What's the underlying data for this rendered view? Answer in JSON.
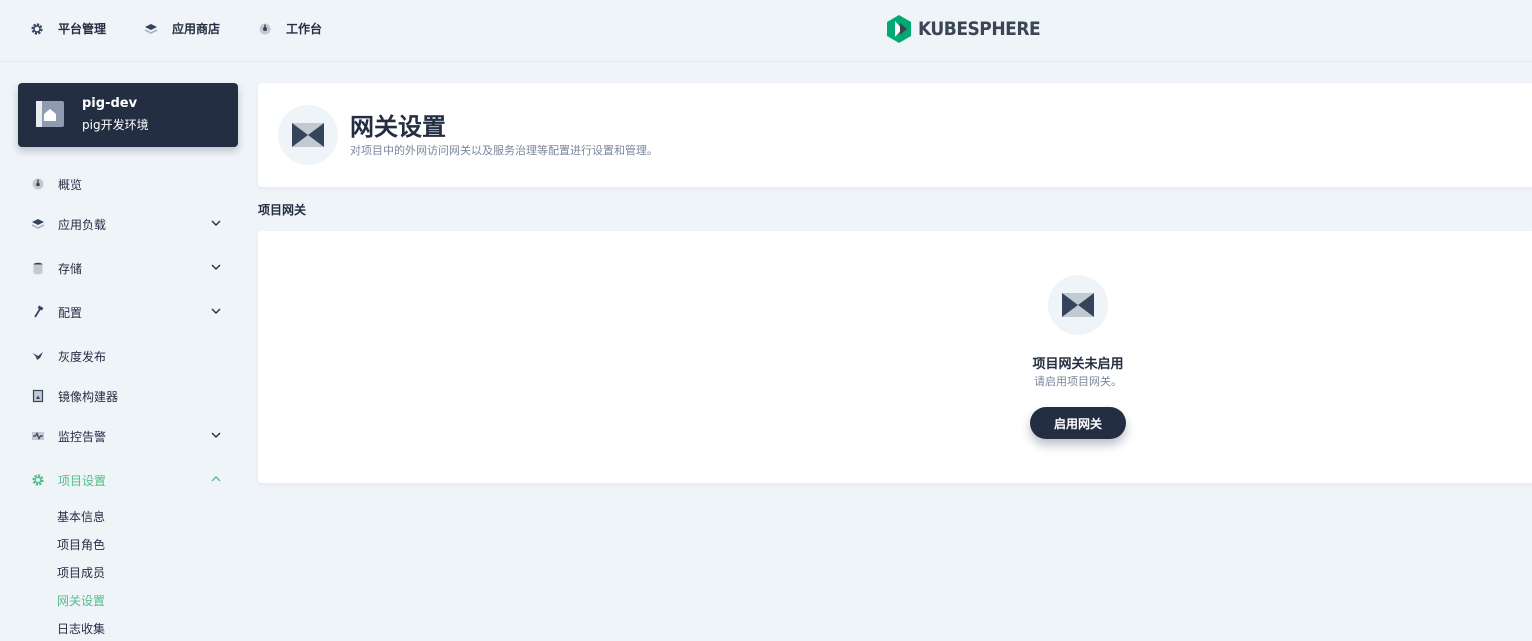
{
  "topnav": {
    "items": [
      {
        "label": "平台管理",
        "icon": "gear-icon"
      },
      {
        "label": "应用商店",
        "icon": "layers-icon"
      },
      {
        "label": "工作台",
        "icon": "dashboard-icon"
      }
    ],
    "logo_text": "KUBESPHERE",
    "brand_color": "#00aa72"
  },
  "project": {
    "name": "pig-dev",
    "description": "pig开发环境"
  },
  "sidebar": {
    "items": [
      {
        "label": "概览",
        "icon": "dashboard-icon",
        "expandable": false
      },
      {
        "label": "应用负载",
        "icon": "layers-icon",
        "expandable": true
      },
      {
        "label": "存储",
        "icon": "database-icon",
        "expandable": true
      },
      {
        "label": "配置",
        "icon": "hammer-icon",
        "expandable": true
      },
      {
        "label": "灰度发布",
        "icon": "bird-icon",
        "expandable": false
      },
      {
        "label": "镜像构建器",
        "icon": "image-builder-icon",
        "expandable": false
      },
      {
        "label": "监控告警",
        "icon": "monitor-icon",
        "expandable": true
      },
      {
        "label": "项目设置",
        "icon": "gear-icon",
        "expandable": true,
        "expanded": true,
        "active": true
      }
    ],
    "subitems": [
      {
        "label": "基本信息"
      },
      {
        "label": "项目角色"
      },
      {
        "label": "项目成员"
      },
      {
        "label": "网关设置",
        "active": true
      },
      {
        "label": "日志收集"
      }
    ],
    "active_color": "#55bc8a"
  },
  "header": {
    "title": "网关设置",
    "description": "对项目中的外网访问网关以及服务治理等配置进行设置和管理。"
  },
  "section": {
    "title": "项目网关"
  },
  "empty": {
    "title": "项目网关未启用",
    "description": "请启用项目网关。",
    "button_label": "启用网关"
  }
}
